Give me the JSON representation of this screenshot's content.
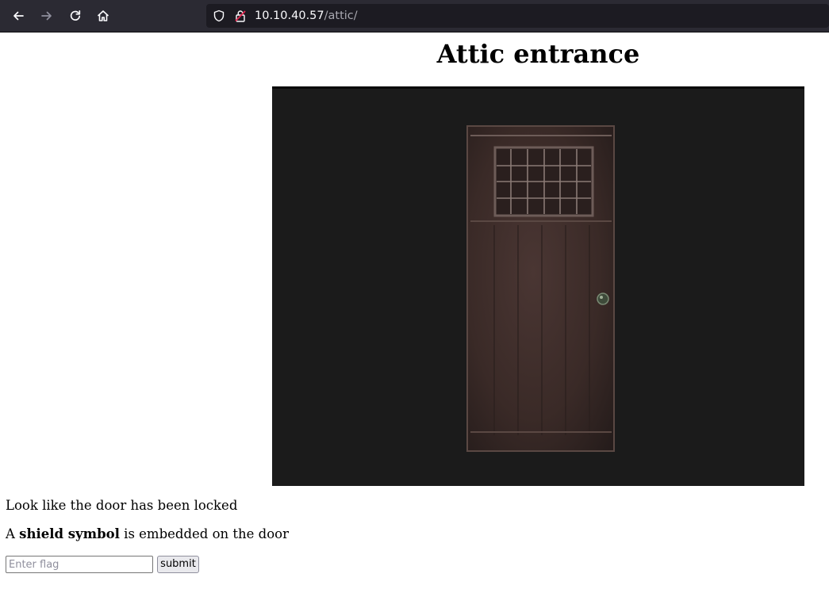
{
  "browser": {
    "url_host": "10.10.40.57",
    "url_path": "/attic/",
    "icons": [
      "back-arrow-icon",
      "forward-arrow-icon",
      "reload-icon",
      "home-icon",
      "shield-icon",
      "insecure-lock-icon"
    ]
  },
  "page": {
    "title": "Attic entrance",
    "image_subject": "dark wooden door",
    "line1": "Look like the door has been locked",
    "line2_prefix": "A ",
    "line2_bold": "shield symbol",
    "line2_suffix": " is embedded on the door"
  },
  "form": {
    "placeholder": "Enter flag",
    "value": "",
    "submit_label": "submit"
  },
  "colors": {
    "toolbar_bg": "#2b2a33",
    "urlbar_bg": "#1c1b22",
    "image_bg": "#1b1b1b",
    "door": "#3a2a26"
  }
}
